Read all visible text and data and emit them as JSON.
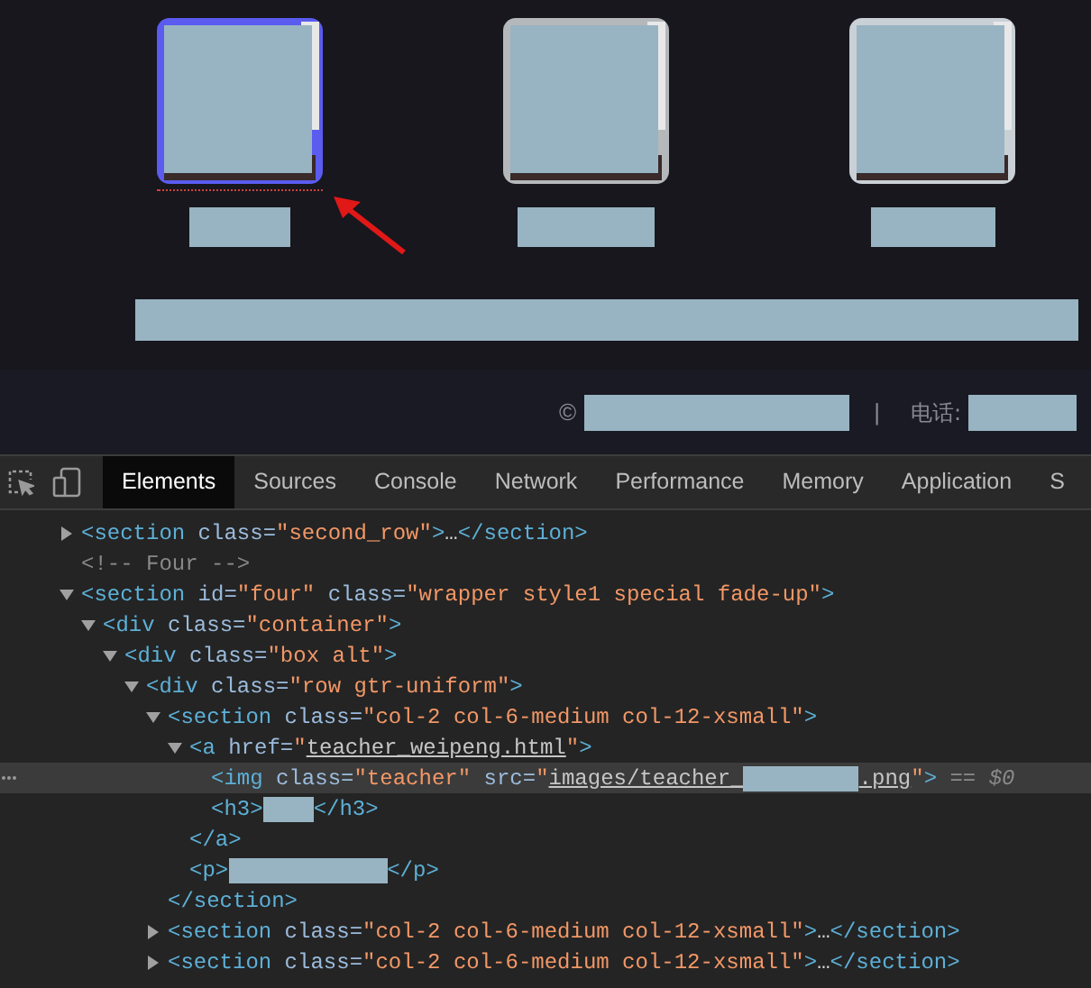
{
  "page": {
    "cards": [
      {
        "kind": "picture",
        "highlighted": true
      },
      {
        "kind": "picture",
        "highlighted": false
      },
      {
        "kind": "picture",
        "highlighted": false
      }
    ],
    "footer": {
      "copyright": "©",
      "separator": "|",
      "phone_label": "电话:"
    }
  },
  "devtools": {
    "tabs": [
      {
        "label": "Elements",
        "selected": true
      },
      {
        "label": "Sources",
        "selected": false
      },
      {
        "label": "Console",
        "selected": false
      },
      {
        "label": "Network",
        "selected": false
      },
      {
        "label": "Performance",
        "selected": false
      },
      {
        "label": "Memory",
        "selected": false
      },
      {
        "label": "Application",
        "selected": false
      },
      {
        "label": "S",
        "selected": false
      }
    ],
    "tree": [
      {
        "expanded": false,
        "selected": false,
        "tokens": [
          {
            "kind": "tag",
            "text": "<section"
          },
          {
            "kind": "attr",
            "text": " class="
          },
          {
            "kind": "value",
            "text": "\"second_row\""
          },
          {
            "kind": "tag",
            "text": ">"
          },
          {
            "kind": "text",
            "text": "…"
          },
          {
            "kind": "tag",
            "text": "</section>"
          }
        ]
      },
      {
        "selected": false,
        "tokens": [
          {
            "kind": "comment",
            "text": "<!-- Four -->"
          }
        ]
      },
      {
        "expanded": true,
        "selected": false,
        "tokens": [
          {
            "kind": "tag",
            "text": "<section"
          },
          {
            "kind": "attr",
            "text": " id="
          },
          {
            "kind": "value",
            "text": "\"four\""
          },
          {
            "kind": "attr",
            "text": " class="
          },
          {
            "kind": "value",
            "text": "\"wrapper style1 special fade-up\""
          },
          {
            "kind": "tag",
            "text": ">"
          }
        ],
        "children": [
          {
            "expanded": true,
            "selected": false,
            "tokens": [
              {
                "kind": "tag",
                "text": "<div"
              },
              {
                "kind": "attr",
                "text": " class="
              },
              {
                "kind": "value",
                "text": "\"container\""
              },
              {
                "kind": "tag",
                "text": ">"
              }
            ],
            "children": [
              {
                "expanded": true,
                "selected": false,
                "tokens": [
                  {
                    "kind": "tag",
                    "text": "<div"
                  },
                  {
                    "kind": "attr",
                    "text": " class="
                  },
                  {
                    "kind": "value",
                    "text": "\"box alt\""
                  },
                  {
                    "kind": "tag",
                    "text": ">"
                  }
                ],
                "children": [
                  {
                    "expanded": true,
                    "selected": false,
                    "tokens": [
                      {
                        "kind": "tag",
                        "text": "<div"
                      },
                      {
                        "kind": "attr",
                        "text": " class="
                      },
                      {
                        "kind": "value",
                        "text": "\"row gtr-uniform\""
                      },
                      {
                        "kind": "tag",
                        "text": ">"
                      }
                    ],
                    "children": [
                      {
                        "expanded": true,
                        "selected": false,
                        "tokens": [
                          {
                            "kind": "tag",
                            "text": "<section"
                          },
                          {
                            "kind": "attr",
                            "text": " class="
                          },
                          {
                            "kind": "value",
                            "text": "\"col-2 col-6-medium col-12-xsmall\""
                          },
                          {
                            "kind": "tag",
                            "text": ">"
                          }
                        ],
                        "children": [
                          {
                            "expanded": true,
                            "selected": false,
                            "tokens": [
                              {
                                "kind": "tag",
                                "text": "<a"
                              },
                              {
                                "kind": "attr",
                                "text": " href="
                              },
                              {
                                "kind": "value",
                                "text": "\""
                              },
                              {
                                "kind": "link",
                                "text": "teacher_weipeng.html"
                              },
                              {
                                "kind": "value",
                                "text": "\""
                              },
                              {
                                "kind": "tag",
                                "text": ">"
                              }
                            ],
                            "children": [
                              {
                                "selected": true,
                                "tokens": [
                                  {
                                    "kind": "tag",
                                    "text": "<img"
                                  },
                                  {
                                    "kind": "attr",
                                    "text": " class="
                                  },
                                  {
                                    "kind": "value",
                                    "text": "\"teacher\""
                                  },
                                  {
                                    "kind": "attr",
                                    "text": " src="
                                  },
                                  {
                                    "kind": "value",
                                    "text": "\""
                                  },
                                  {
                                    "kind": "link",
                                    "text": "images/teacher_"
                                  },
                                  {
                                    "kind": "redacted-m"
                                  },
                                  {
                                    "kind": "link",
                                    "text": ".png"
                                  },
                                  {
                                    "kind": "value",
                                    "text": "\""
                                  },
                                  {
                                    "kind": "tag",
                                    "text": ">"
                                  },
                                  {
                                    "kind": "dim",
                                    "text": " == $0"
                                  }
                                ]
                              },
                              {
                                "selected": false,
                                "tokens": [
                                  {
                                    "kind": "tag",
                                    "text": "<h3>"
                                  },
                                  {
                                    "kind": "redacted-s"
                                  },
                                  {
                                    "kind": "tag",
                                    "text": "</h3>"
                                  }
                                ]
                              }
                            ],
                            "close": [
                              {
                                "kind": "tag",
                                "text": "</a>"
                              }
                            ]
                          },
                          {
                            "selected": false,
                            "tokens": [
                              {
                                "kind": "tag",
                                "text": "<p>"
                              },
                              {
                                "kind": "redacted-l"
                              },
                              {
                                "kind": "tag",
                                "text": "</p>"
                              }
                            ]
                          }
                        ],
                        "close": [
                          {
                            "kind": "tag",
                            "text": "</section>"
                          }
                        ]
                      },
                      {
                        "expanded": false,
                        "selected": false,
                        "tokens": [
                          {
                            "kind": "tag",
                            "text": "<section"
                          },
                          {
                            "kind": "attr",
                            "text": " class="
                          },
                          {
                            "kind": "value",
                            "text": "\"col-2 col-6-medium col-12-xsmall\""
                          },
                          {
                            "kind": "tag",
                            "text": ">"
                          },
                          {
                            "kind": "text",
                            "text": "…"
                          },
                          {
                            "kind": "tag",
                            "text": "</section>"
                          }
                        ]
                      },
                      {
                        "expanded": false,
                        "selected": false,
                        "tokens": [
                          {
                            "kind": "tag",
                            "text": "<section"
                          },
                          {
                            "kind": "attr",
                            "text": " class="
                          },
                          {
                            "kind": "value",
                            "text": "\"col-2 col-6-medium col-12-xsmall\""
                          },
                          {
                            "kind": "tag",
                            "text": ">"
                          },
                          {
                            "kind": "text",
                            "text": "…"
                          },
                          {
                            "kind": "tag",
                            "text": "</section>"
                          }
                        ]
                      }
                    ]
                  }
                ]
              }
            ]
          }
        ]
      }
    ]
  }
}
